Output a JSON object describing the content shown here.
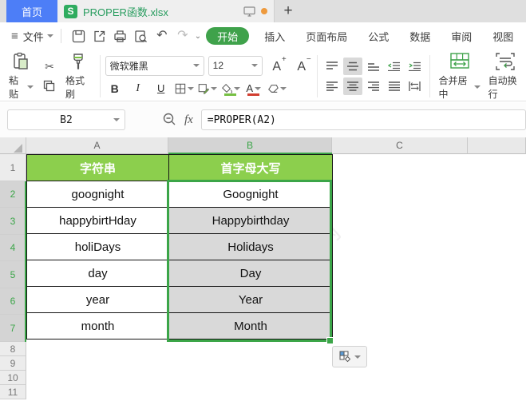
{
  "tabbar": {
    "home_tab": "首页",
    "doc_tab_title": "PROPER函数.xlsx",
    "new_tab": "+"
  },
  "menubar": {
    "file_label": "文件",
    "active_tab": "开始",
    "tabs": [
      "插入",
      "页面布局",
      "公式",
      "数据",
      "审阅",
      "视图"
    ]
  },
  "toolbar": {
    "paste_label": "粘贴",
    "format_painter_label": "格式刷",
    "font_name": "微软雅黑",
    "font_size": "12",
    "font_increase": {
      "letter": "A",
      "sign": "+"
    },
    "font_decrease": {
      "letter": "A",
      "sign": "−"
    },
    "bold": "B",
    "italic": "I",
    "underline": "U",
    "merge_center_label": "合并居中",
    "wrap_text_label": "自动换行"
  },
  "formula_bar": {
    "name_box": "B2",
    "fx_label": "fx",
    "formula": "=PROPER(A2)"
  },
  "sheet": {
    "column_headers": [
      "A",
      "B",
      "C"
    ],
    "selected_column": "B",
    "row_numbers": [
      "1",
      "2",
      "3",
      "4",
      "5",
      "6",
      "7",
      "8",
      "9",
      "10",
      "11"
    ],
    "table_headers": [
      "字符串",
      "首字母大写"
    ],
    "table_rows": [
      [
        "goognight",
        "Goognight"
      ],
      [
        "happybirtHday",
        "Happybirthday"
      ],
      [
        "holiDays",
        "Holidays"
      ],
      [
        "day",
        "Day"
      ],
      [
        "year",
        "Year"
      ],
      [
        "month",
        "Month"
      ]
    ],
    "active_cell": "B2",
    "watermark": "软件自学网"
  },
  "colors": {
    "accent_green": "#3fa24b",
    "selection_green": "#3ba548",
    "header_fill_green": "#8ccf4d",
    "selected_fill_gray": "#d9d9d9",
    "tab_blue": "#4d7ef7",
    "unsaved_orange": "#ee9a3d",
    "font_color_red": "#d23f31",
    "fill_color_green": "#76c043"
  }
}
